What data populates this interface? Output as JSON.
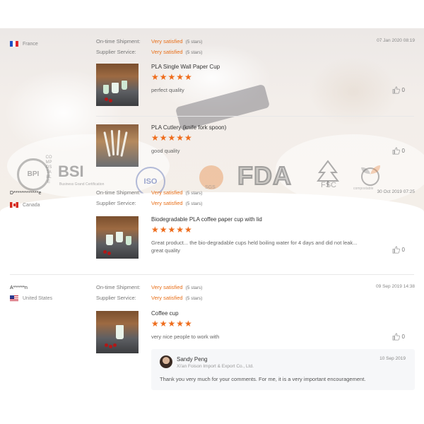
{
  "labels": {
    "ontime": "On-time Shipment:",
    "supplier": "Supplier Service:"
  },
  "brand_colors": {
    "accent": "#e8701a",
    "star": "#ee6c1c"
  },
  "certifications": {
    "bpi": "BPI",
    "bpi_tag": "COMPOSTABLE",
    "bsi": "BSI",
    "bsi_sub": "Business Grand Certification",
    "iso": "ISO",
    "sgs": "SGS",
    "fda": "FDA",
    "fsc": "FSC",
    "compostable": "compostable"
  },
  "reviews": [
    {
      "user": "",
      "country": "France",
      "flag": "fr",
      "date": "07 Jan 2020 08:19",
      "ontime_value": "Very satisfied",
      "ontime_stars": "(5 stars)",
      "supplier_value": "Very satisfied",
      "supplier_stars": "(5 stars)",
      "items": [
        {
          "product": "PLA Single Wall Paper Cup",
          "rating": 5,
          "stars": "★★★★★",
          "comment": "perfect quality",
          "likes": "0"
        },
        {
          "product": "PLA Cutlery (knife fork spoon)",
          "rating": 5,
          "stars": "★★★★★",
          "comment": "good quality",
          "likes": "0"
        }
      ]
    },
    {
      "user": "D*************e",
      "country": "Canada",
      "flag": "ca",
      "date": "30 Oct 2019 07:25",
      "ontime_value": "Very satisfied",
      "ontime_stars": "(5 stars)",
      "supplier_value": "Very satisfied",
      "supplier_stars": "(5 stars)",
      "items": [
        {
          "product": "Biodegradable PLA coffee paper cup with lid",
          "rating": 5,
          "stars": "★★★★★",
          "comment": "Great product... the bio-degradable cups held boiling water for 4 days and did not leak... great quality",
          "likes": "0"
        }
      ]
    },
    {
      "user": "A******n",
      "country": "United States",
      "flag": "us",
      "date": "09 Sep 2019 14:38",
      "ontime_value": "Very satisfied",
      "ontime_stars": "(5 stars)",
      "supplier_value": "Very satisfied",
      "supplier_stars": "(5 stars)",
      "items": [
        {
          "product": "Coffee cup",
          "rating": 5,
          "stars": "★★★★★",
          "comment": "very nice people to work with",
          "likes": "0"
        }
      ],
      "reply": {
        "name": "Sandy Peng",
        "company": "Xi'an Foison Import & Export Co., Ltd.",
        "date": "10 Sep 2019",
        "text": "Thank you very much for your comments. For me, it is a very important encouragement."
      }
    }
  ],
  "icons": {
    "like": "thumbs-up-icon",
    "avatar": "avatar"
  }
}
